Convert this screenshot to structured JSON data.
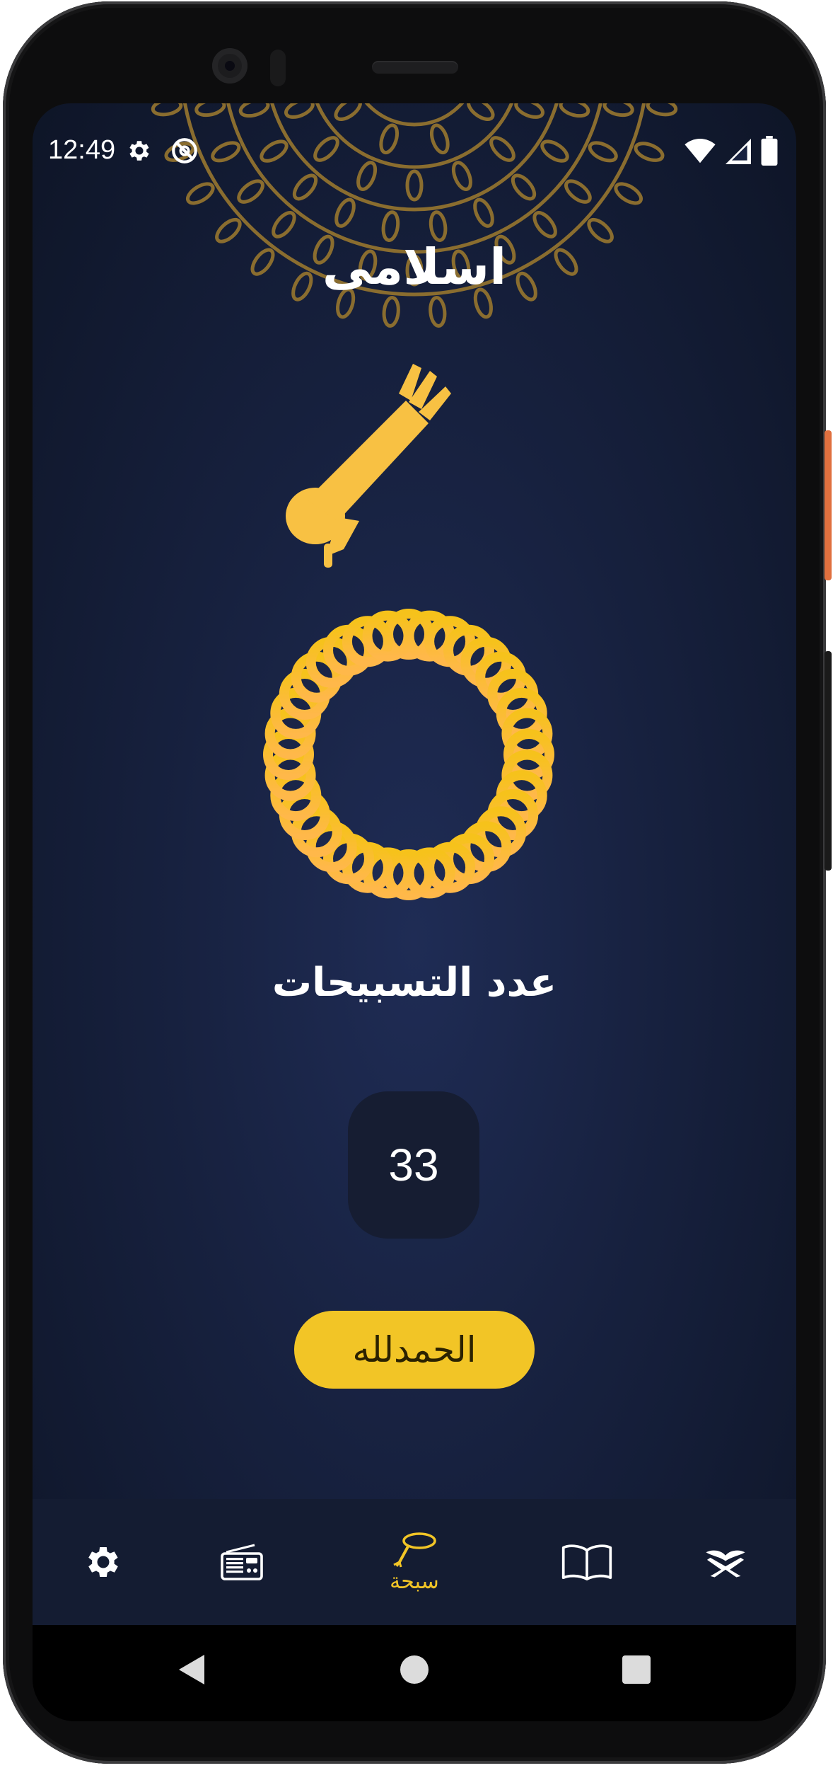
{
  "status_bar": {
    "time": "12:49",
    "left_icons": [
      "settings-icon",
      "do-not-disturb-icon"
    ],
    "right_icons": [
      "wifi-icon",
      "cell-signal-icon",
      "battery-icon"
    ]
  },
  "app": {
    "title": "اسلامى"
  },
  "tasbeeh": {
    "counter_label": "عدد التسبيحات",
    "count": "33",
    "dhikr_button": "الحمدلله"
  },
  "bottom_nav": {
    "items": [
      {
        "icon": "settings-icon",
        "label": ""
      },
      {
        "icon": "radio-icon",
        "label": ""
      },
      {
        "icon": "tasbeeh-icon",
        "label": "سبحة",
        "active": true
      },
      {
        "icon": "book-icon",
        "label": ""
      },
      {
        "icon": "quran-icon",
        "label": ""
      }
    ]
  },
  "system_nav": {
    "buttons": [
      "back-button",
      "home-button",
      "recents-button"
    ]
  },
  "colors": {
    "background": "#17213f",
    "accent": "#f2c526",
    "nav_background": "#141c32",
    "counter_box": "#161d32"
  }
}
